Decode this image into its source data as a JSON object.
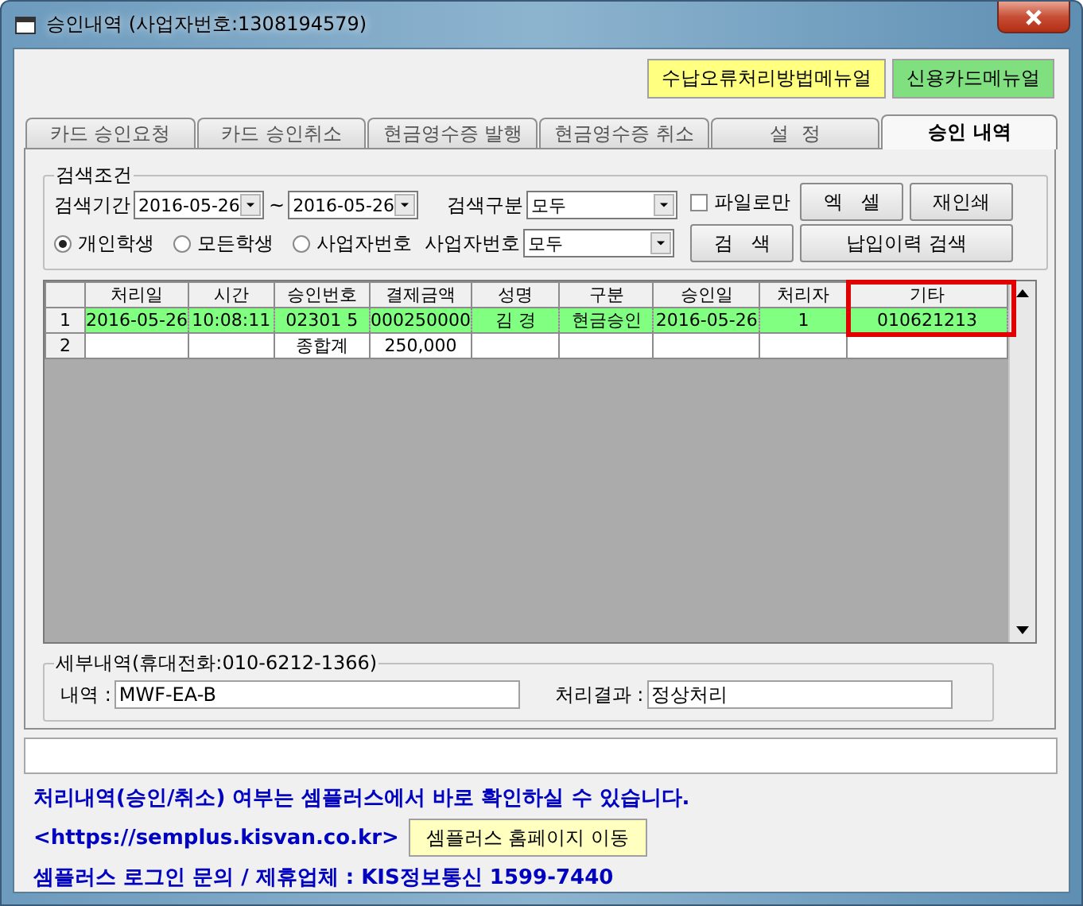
{
  "window": {
    "title": "승인내역 (사업자번호:1308194579)"
  },
  "top_buttons": [
    {
      "label": "수납오류처리방법메뉴얼",
      "color": "#ffff80"
    },
    {
      "label": "신용카드메뉴얼",
      "color": "#80e080"
    }
  ],
  "tabs": [
    {
      "label": "카드 승인요청",
      "selected": false
    },
    {
      "label": "카드 승인취소",
      "selected": false
    },
    {
      "label": "현금영수증 발행",
      "selected": false
    },
    {
      "label": "현금영수증 취소",
      "selected": false
    },
    {
      "label": "설  정",
      "selected": false
    },
    {
      "label": "승인 내역",
      "selected": true
    }
  ],
  "search": {
    "title": "검색조건",
    "period_label": "검색기간",
    "date_from": "2016-05-26",
    "separator": "~",
    "date_to": "2016-05-26",
    "type_label": "검색구분",
    "type_value": "모두",
    "bizno_label": "사업자번호",
    "bizno_value": "모두",
    "file_only": {
      "label": "파일로만",
      "checked": false
    },
    "radios": [
      {
        "label": "개인학생",
        "selected": true
      },
      {
        "label": "모든학생",
        "selected": false
      },
      {
        "label": "사업자번호",
        "selected": false
      }
    ],
    "buttons": [
      {
        "label": "엑   셀"
      },
      {
        "label": "재인쇄"
      },
      {
        "label": "검   색"
      },
      {
        "label": "납입이력 검색"
      }
    ]
  },
  "table": {
    "columns": [
      {
        "label": "처리일",
        "highlighted": false
      },
      {
        "label": "시간",
        "highlighted": false
      },
      {
        "label": "승인번호",
        "highlighted": false
      },
      {
        "label": "결제금액",
        "highlighted": false
      },
      {
        "label": "성명",
        "highlighted": false
      },
      {
        "label": "구분",
        "highlighted": false
      },
      {
        "label": "승인일",
        "highlighted": false
      },
      {
        "label": "처리자",
        "highlighted": false
      },
      {
        "label": "기타",
        "highlighted": true
      }
    ],
    "rows": [
      {
        "number": "1",
        "selected": true,
        "cells": [
          "2016-05-26",
          "10:08:11",
          "02301   5",
          "000250000",
          "김  경",
          "현금승인",
          "2016-05-26",
          "1",
          "010621213"
        ]
      },
      {
        "number": "2",
        "selected": false,
        "cells": [
          null,
          null,
          "종합계",
          "250,000",
          null,
          null,
          null,
          null,
          null
        ]
      }
    ]
  },
  "details": {
    "title": "세부내역(휴대전화:010-6212-1366)",
    "item_label": "내역 :",
    "item_value": "MWF-EA-B",
    "result_label": "처리결과 :",
    "result_value": "정상처리"
  },
  "notice": {
    "line1": "처리내역(승인/취소) 여부는 셈플러스에서 바로 확인하실 수 있습니다.",
    "url": "<https://semplus.kisvan.co.kr>",
    "home_button": "셈플러스 홈페이지 이동",
    "line3": "셈플러스 로그인 문의 / 제휴업체 : KIS정보통신 1599-7440"
  }
}
